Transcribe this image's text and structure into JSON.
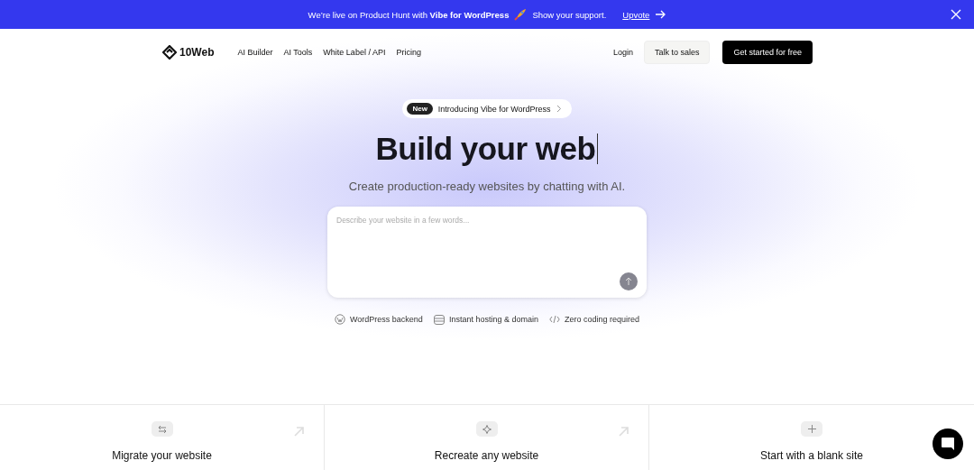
{
  "banner": {
    "text": "We’re live on Product Hunt with **Vibe for WordPress**",
    "support": "Show your support.",
    "link": "Upvote"
  },
  "nav": {
    "logo": "10Web",
    "links": [
      "AI Builder",
      "AI Tools",
      "White Label / API",
      "Pricing"
    ],
    "login": "Login",
    "sales": "Talk to sales",
    "cta": "Get started for free"
  },
  "hero": {
    "badge": {
      "tag": "New",
      "text": "Introducing Vibe for WordPress"
    },
    "title": "Build your web",
    "subtitle": "Create production-ready websites by chatting with AI.",
    "prompt": {
      "placeholder": "Describe your website in a few words..."
    },
    "features": [
      {
        "kind": "wordpress",
        "label": "WordPress backend"
      },
      {
        "kind": "hosting",
        "label": "Instant hosting & domain"
      },
      {
        "kind": "code",
        "label": "Zero coding required"
      }
    ]
  },
  "cards": [
    {
      "kind": "migrate",
      "title": "Migrate your website",
      "arrow": true
    },
    {
      "kind": "sparkle",
      "title": "Recreate any website",
      "arrow": true
    },
    {
      "kind": "plus",
      "title": "Start with a blank site",
      "arrow": false
    }
  ]
}
